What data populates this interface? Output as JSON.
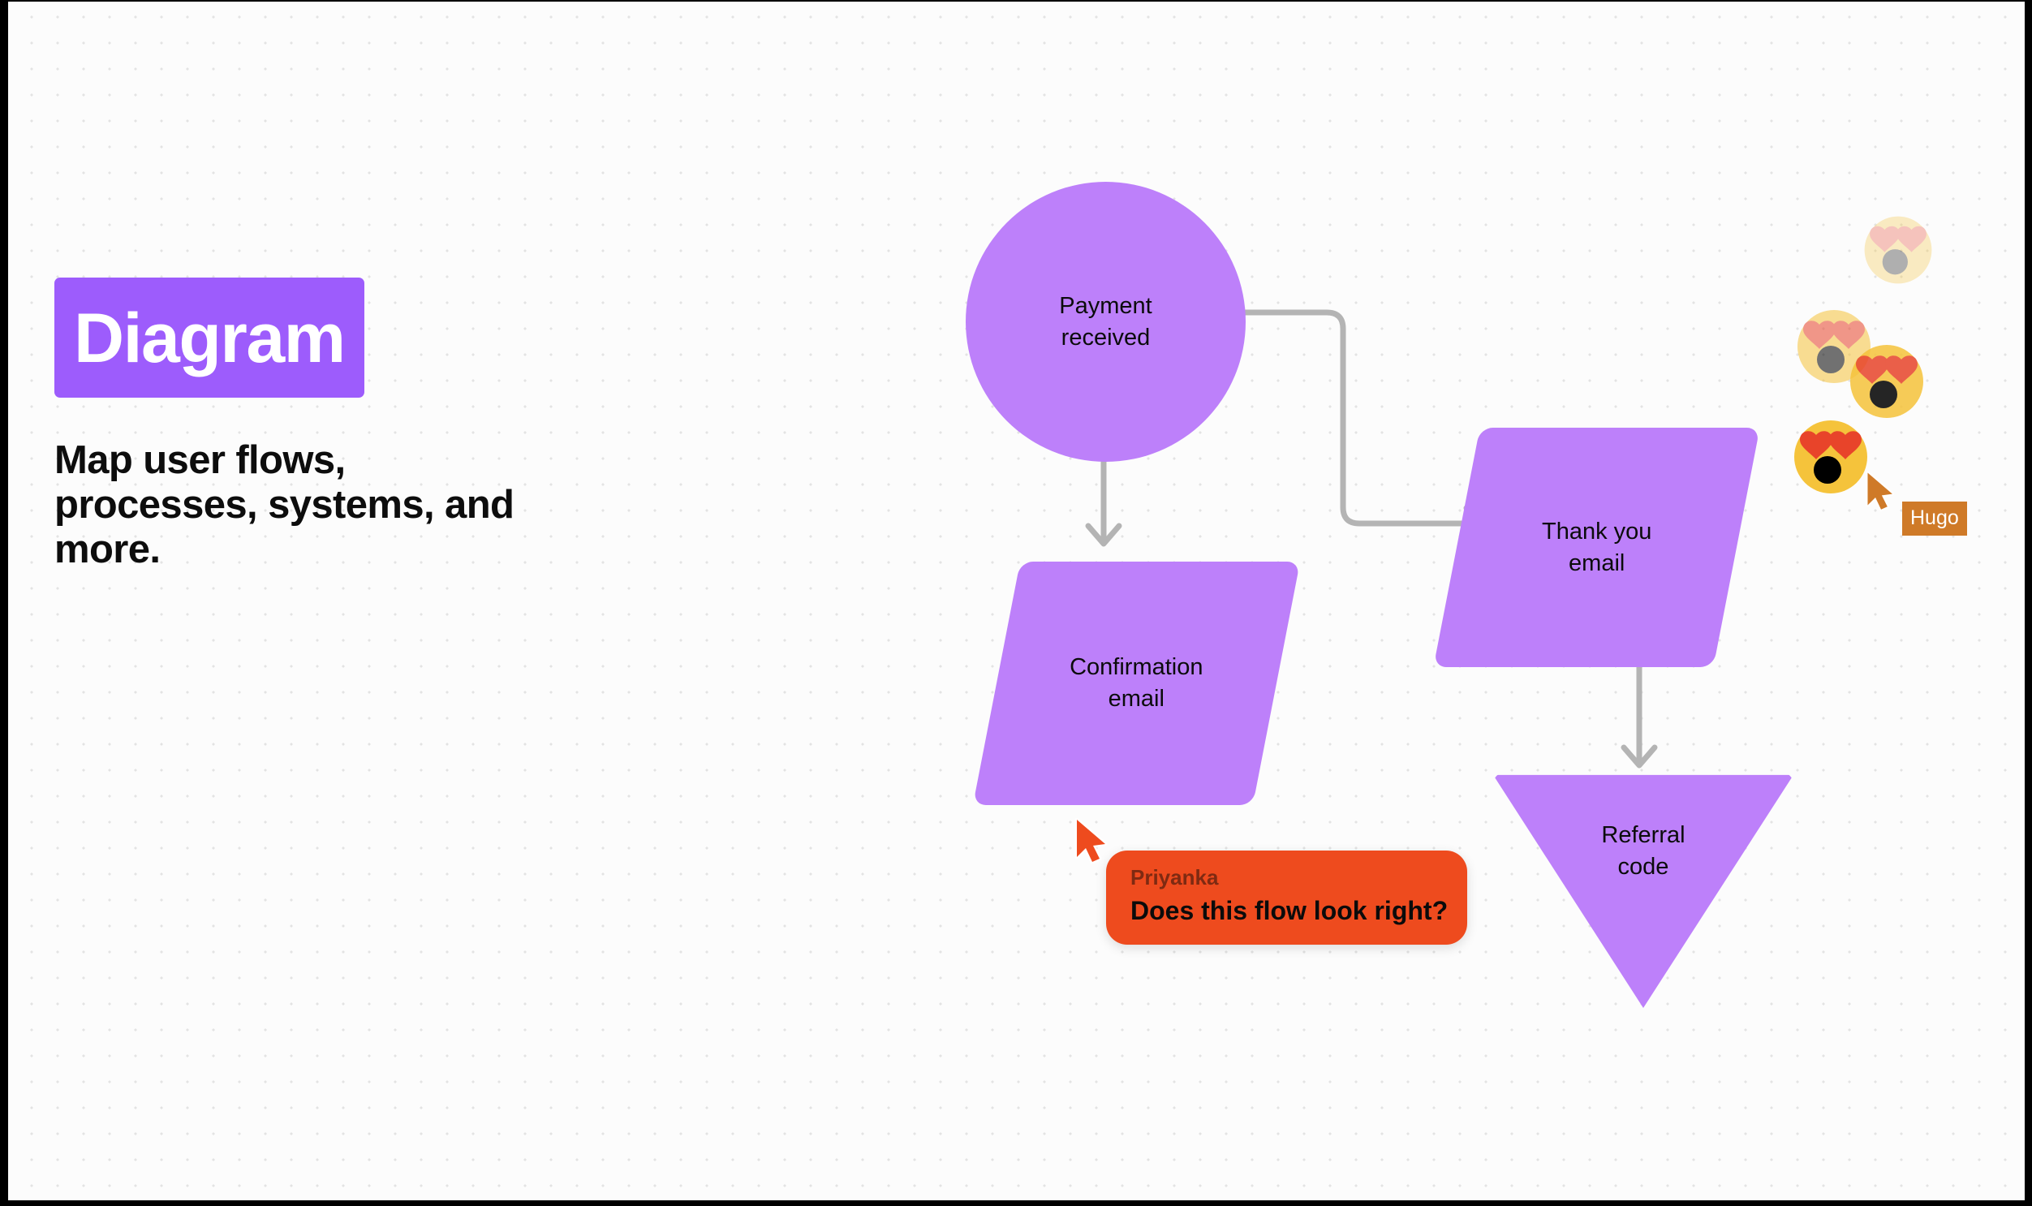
{
  "canvas": {
    "background": "#fcfcfc",
    "dot_color": "#e3e3e3",
    "frame_color": "#000000"
  },
  "promo": {
    "badge_label": "Diagram",
    "badge_color": "#9d5cfc",
    "subtitle": "Map user flows, processes, systems, and more.",
    "subtitle_color": "#0d0d0d"
  },
  "diagram": {
    "shape_fill": "#bd80fa",
    "connector_color": "#b4b4b4",
    "nodes": [
      {
        "id": "payment-received",
        "label": "Payment\nreceived",
        "shape": "circle"
      },
      {
        "id": "confirmation-email",
        "label": "Confirmation\nemail",
        "shape": "parallelogram"
      },
      {
        "id": "thank-you-email",
        "label": "Thank you\nemail",
        "shape": "parallelogram"
      },
      {
        "id": "referral-code",
        "label": "Referral\ncode",
        "shape": "triangle-down"
      }
    ],
    "connectors": [
      {
        "from": "payment-received",
        "to": "confirmation-email",
        "style": "straight-down"
      },
      {
        "from": "payment-received",
        "to": "thank-you-email",
        "style": "elbow-right"
      },
      {
        "from": "thank-you-email",
        "to": "referral-code",
        "style": "straight-down"
      }
    ]
  },
  "comment": {
    "author": "Priyanka",
    "text": "Does this flow look right?",
    "bubble_color": "#ee4b1e",
    "author_color": "#7e2a12"
  },
  "cursors": [
    {
      "id": "priyanka-cursor",
      "name": "",
      "color": "#ee4b1e"
    },
    {
      "id": "hugo-cursor",
      "name": "Hugo",
      "color": "#cf7a28"
    }
  ],
  "reactions": {
    "emoji_name": "heart-eyes-open-mouth",
    "count": 4,
    "items": [
      {
        "opacity": 0.3
      },
      {
        "opacity": 0.55
      },
      {
        "opacity": 0.85
      },
      {
        "opacity": 1.0
      }
    ]
  }
}
